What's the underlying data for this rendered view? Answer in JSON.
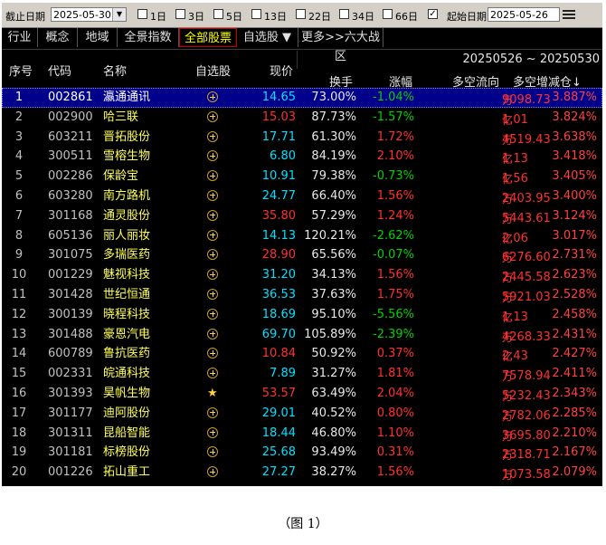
{
  "toolbar": {
    "end_date_label": "截止日期",
    "end_date_value": "2025-05-30",
    "period_options": [
      {
        "label": "1日",
        "checked": false
      },
      {
        "label": "3日",
        "checked": false
      },
      {
        "label": "5日",
        "checked": false
      },
      {
        "label": "13日",
        "checked": false
      },
      {
        "label": "22日",
        "checked": false
      },
      {
        "label": "34日",
        "checked": false
      },
      {
        "label": "66日",
        "checked": false
      }
    ],
    "start_checked": true,
    "start_date_label": "起始日期",
    "start_date_value": "2025-05-26"
  },
  "tabs": [
    {
      "label": "行业",
      "active": false
    },
    {
      "label": "概念",
      "active": false
    },
    {
      "label": "地域",
      "active": false
    },
    {
      "label": "全景指数",
      "active": false
    },
    {
      "label": "全部股票",
      "active": true
    },
    {
      "label": "自选股 ▼",
      "active": false
    },
    {
      "label": "更多>>六大战区",
      "active": false
    }
  ],
  "header": {
    "index": "序号",
    "code": "代码",
    "name": "名称",
    "favorite": "自选股",
    "price": "现价",
    "range": "20250526 ~ 20250530",
    "turnover": "换手",
    "change": "涨幅",
    "flow": "多空流向",
    "increase": "多空增减仓↓"
  },
  "rows": [
    {
      "idx": "1",
      "code": "002861",
      "name": "瀛通通讯",
      "price": "14.65",
      "price_color": "cyan",
      "turnover": "73.00%",
      "change": "-1.04%",
      "change_color": "green",
      "flow": "9098.73",
      "flow_unit": "万",
      "inc": "3.887%",
      "selected": true
    },
    {
      "idx": "2",
      "code": "002900",
      "name": "哈三联",
      "price": "15.03",
      "price_color": "red",
      "turnover": "87.73%",
      "change": "-1.57%",
      "change_color": "green",
      "flow": "1.01",
      "flow_unit": "亿",
      "inc": "3.824%"
    },
    {
      "idx": "3",
      "code": "603211",
      "name": "晋拓股份",
      "price": "17.71",
      "price_color": "cyan",
      "turnover": "61.30%",
      "change": "1.72%",
      "change_color": "red",
      "flow": "4519.43",
      "flow_unit": "万",
      "inc": "3.638%"
    },
    {
      "idx": "4",
      "code": "300511",
      "name": "雪榕生物",
      "price": "6.80",
      "price_color": "cyan",
      "turnover": "84.19%",
      "change": "2.10%",
      "change_color": "red",
      "flow": "1.13",
      "flow_unit": "亿",
      "inc": "3.418%"
    },
    {
      "idx": "5",
      "code": "002286",
      "name": "保龄宝",
      "price": "10.91",
      "price_color": "cyan",
      "turnover": "79.38%",
      "change": "-0.73%",
      "change_color": "green",
      "flow": "1.56",
      "flow_unit": "亿",
      "inc": "3.405%"
    },
    {
      "idx": "6",
      "code": "603280",
      "name": "南方路机",
      "price": "24.77",
      "price_color": "cyan",
      "turnover": "66.40%",
      "change": "1.56%",
      "change_color": "red",
      "flow": "2403.95",
      "flow_unit": "万",
      "inc": "3.400%"
    },
    {
      "idx": "7",
      "code": "301168",
      "name": "通灵股份",
      "price": "35.80",
      "price_color": "red",
      "turnover": "57.29%",
      "change": "1.24%",
      "change_color": "red",
      "flow": "5443.61",
      "flow_unit": "万",
      "inc": "3.124%"
    },
    {
      "idx": "8",
      "code": "605136",
      "name": "丽人丽妆",
      "price": "14.13",
      "price_color": "cyan",
      "turnover": "120.21%",
      "change": "-2.62%",
      "change_color": "green",
      "flow": "2.06",
      "flow_unit": "亿",
      "inc": "3.017%"
    },
    {
      "idx": "9",
      "code": "301075",
      "name": "多瑞医药",
      "price": "28.90",
      "price_color": "red",
      "turnover": "65.56%",
      "change": "-0.07%",
      "change_color": "green",
      "flow": "6276.60",
      "flow_unit": "万",
      "inc": "2.731%"
    },
    {
      "idx": "10",
      "code": "001229",
      "name": "魅视科技",
      "price": "31.20",
      "price_color": "cyan",
      "turnover": "34.13%",
      "change": "1.56%",
      "change_color": "red",
      "flow": "2445.58",
      "flow_unit": "万",
      "inc": "2.623%"
    },
    {
      "idx": "11",
      "code": "301428",
      "name": "世纪恒通",
      "price": "36.53",
      "price_color": "cyan",
      "turnover": "37.63%",
      "change": "1.75%",
      "change_color": "red",
      "flow": "5921.03",
      "flow_unit": "万",
      "inc": "2.528%"
    },
    {
      "idx": "12",
      "code": "300139",
      "name": "晓程科技",
      "price": "18.69",
      "price_color": "cyan",
      "turnover": "95.10%",
      "change": "-5.56%",
      "change_color": "green",
      "flow": "1.13",
      "flow_unit": "亿",
      "inc": "2.458%"
    },
    {
      "idx": "13",
      "code": "301488",
      "name": "豪恩汽电",
      "price": "69.70",
      "price_color": "cyan",
      "turnover": "105.89%",
      "change": "-2.39%",
      "change_color": "green",
      "flow": "4268.33",
      "flow_unit": "万",
      "inc": "2.431%"
    },
    {
      "idx": "14",
      "code": "600789",
      "name": "鲁抗医药",
      "price": "10.84",
      "price_color": "red",
      "turnover": "50.92%",
      "change": "0.37%",
      "change_color": "red",
      "flow": "2.43",
      "flow_unit": "亿",
      "inc": "2.427%"
    },
    {
      "idx": "15",
      "code": "002331",
      "name": "皖通科技",
      "price": "7.89",
      "price_color": "cyan",
      "turnover": "31.27%",
      "change": "1.81%",
      "change_color": "red",
      "flow": "7578.94",
      "flow_unit": "万",
      "inc": "2.411%"
    },
    {
      "idx": "16",
      "code": "301393",
      "name": "昊帆生物",
      "price": "53.57",
      "price_color": "red",
      "turnover": "63.49%",
      "change": "2.04%",
      "change_color": "red",
      "flow": "5232.43",
      "flow_unit": "万",
      "inc": "2.343%",
      "star": true
    },
    {
      "idx": "17",
      "code": "301177",
      "name": "迪阿股份",
      "price": "29.01",
      "price_color": "cyan",
      "turnover": "40.52%",
      "change": "0.80%",
      "change_color": "red",
      "flow": "2782.06",
      "flow_unit": "万",
      "inc": "2.285%"
    },
    {
      "idx": "18",
      "code": "301311",
      "name": "昆船智能",
      "price": "18.44",
      "price_color": "cyan",
      "turnover": "46.80%",
      "change": "1.10%",
      "change_color": "red",
      "flow": "3695.80",
      "flow_unit": "万",
      "inc": "2.210%"
    },
    {
      "idx": "19",
      "code": "301181",
      "name": "标榜股份",
      "price": "25.68",
      "price_color": "cyan",
      "turnover": "93.49%",
      "change": "0.31%",
      "change_color": "red",
      "flow": "2318.71",
      "flow_unit": "万",
      "inc": "2.167%"
    },
    {
      "idx": "20",
      "code": "001226",
      "name": "拓山重工",
      "price": "27.27",
      "price_color": "cyan",
      "turnover": "38.27%",
      "change": "1.56%",
      "change_color": "red",
      "flow": "1073.58",
      "flow_unit": "万",
      "inc": "2.079%"
    }
  ],
  "caption": "（图 1）"
}
